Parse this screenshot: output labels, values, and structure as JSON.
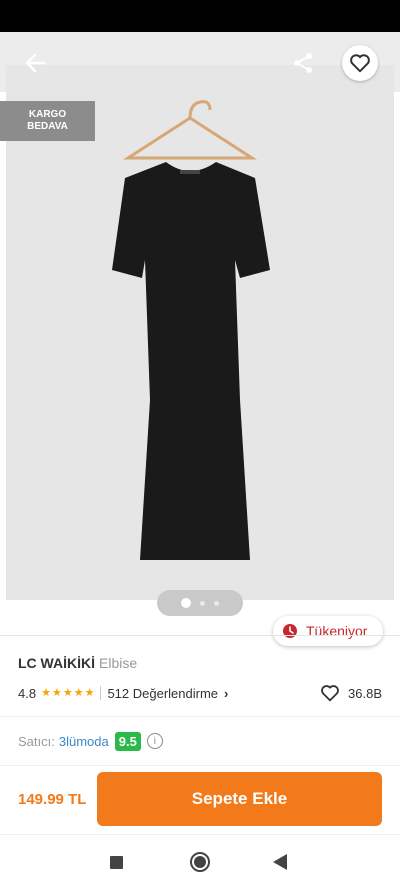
{
  "gallery": {
    "badge_line1": "KARGO",
    "badge_line2": "BEDAVA",
    "pager_count": 3,
    "pager_active": 1,
    "product_colors": {
      "dress": "#1a1a1a",
      "hanger": "#d6a777",
      "background": "#e6e6e6"
    }
  },
  "stock": {
    "label": "Tükeniyor",
    "icon": "clock-icon",
    "color": "#c7282c"
  },
  "product": {
    "brand": "LC WAİKİKİ",
    "category": "Elbise",
    "rating": "4.8",
    "stars": 5,
    "reviews": "512 Değerlendirme",
    "likes": "36.8B"
  },
  "seller": {
    "prefix": "Satıcı:",
    "name": "3lümoda",
    "score": "9.5"
  },
  "footer": {
    "price": "149.99 TL",
    "cart_label": "Sepete Ekle",
    "accent": "#f27a1a"
  },
  "icons": [
    "back-arrow-icon",
    "share-icon",
    "heart-icon",
    "clock-icon",
    "star-icon",
    "chevron-right-icon",
    "info-icon",
    "nav-square-icon",
    "nav-home-icon",
    "nav-back-icon"
  ]
}
